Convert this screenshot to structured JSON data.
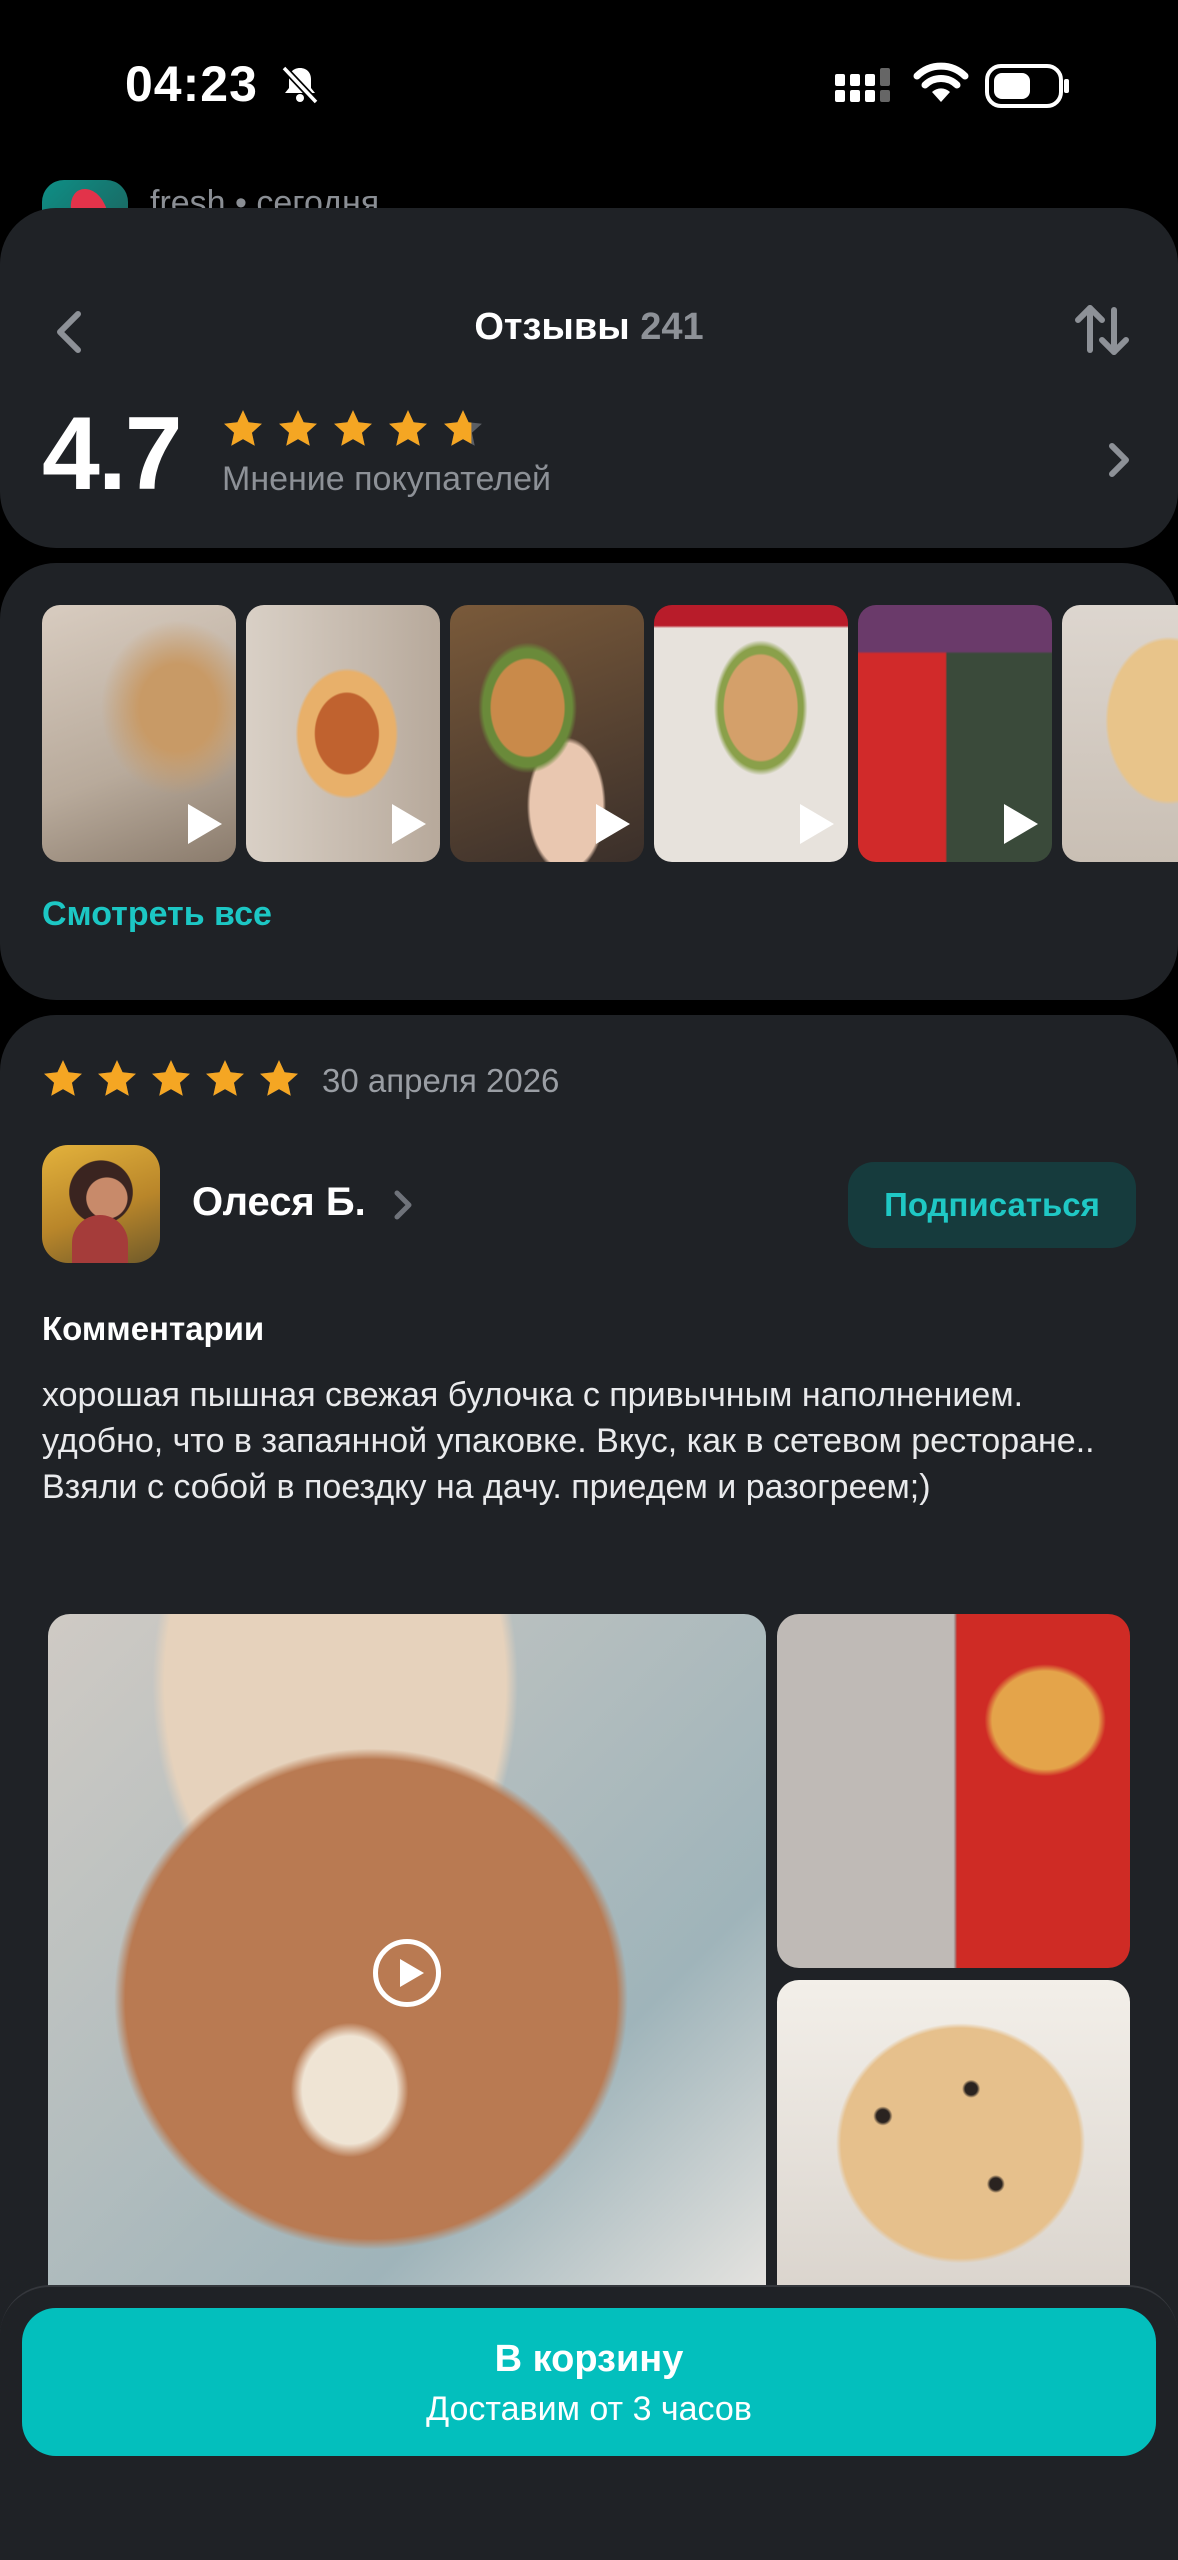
{
  "status_bar": {
    "time": "04:23"
  },
  "store_peek": {
    "text": "fresh • сегодня"
  },
  "header": {
    "title": "Отзывы",
    "count": "241",
    "rating": "4.7",
    "rating_value": 4.7,
    "rating_caption": "Мнение покупателей"
  },
  "media": {
    "see_all": "Смотреть все",
    "thumbnails": [
      {
        "name": "video-thumb-1",
        "kind": "video"
      },
      {
        "name": "video-thumb-2",
        "kind": "video"
      },
      {
        "name": "video-thumb-3",
        "kind": "video"
      },
      {
        "name": "video-thumb-4",
        "kind": "video"
      },
      {
        "name": "video-thumb-5",
        "kind": "video"
      },
      {
        "name": "photo-thumb-6",
        "kind": "photo"
      }
    ]
  },
  "review": {
    "stars": 5,
    "date": "30 апреля 2026",
    "author": "Олеся Б.",
    "subscribe_label": "Подписаться",
    "comment_label": "Комментарии",
    "comment": "хорошая пышная свежая булочка с привычным наполнением. удобно, что в запаянной упаковке. Вкус, как в сетевом ресторане.. Взяли с собой в поездку на дачу. приедем и разогреем;)"
  },
  "cart": {
    "label": "В корзину",
    "sub": "Доставим от 3 часов"
  },
  "colors": {
    "accent": "#03bfbd",
    "link": "#1cc7c4",
    "star": "#f5a623",
    "card": "#1f2226",
    "background": "#000000"
  }
}
